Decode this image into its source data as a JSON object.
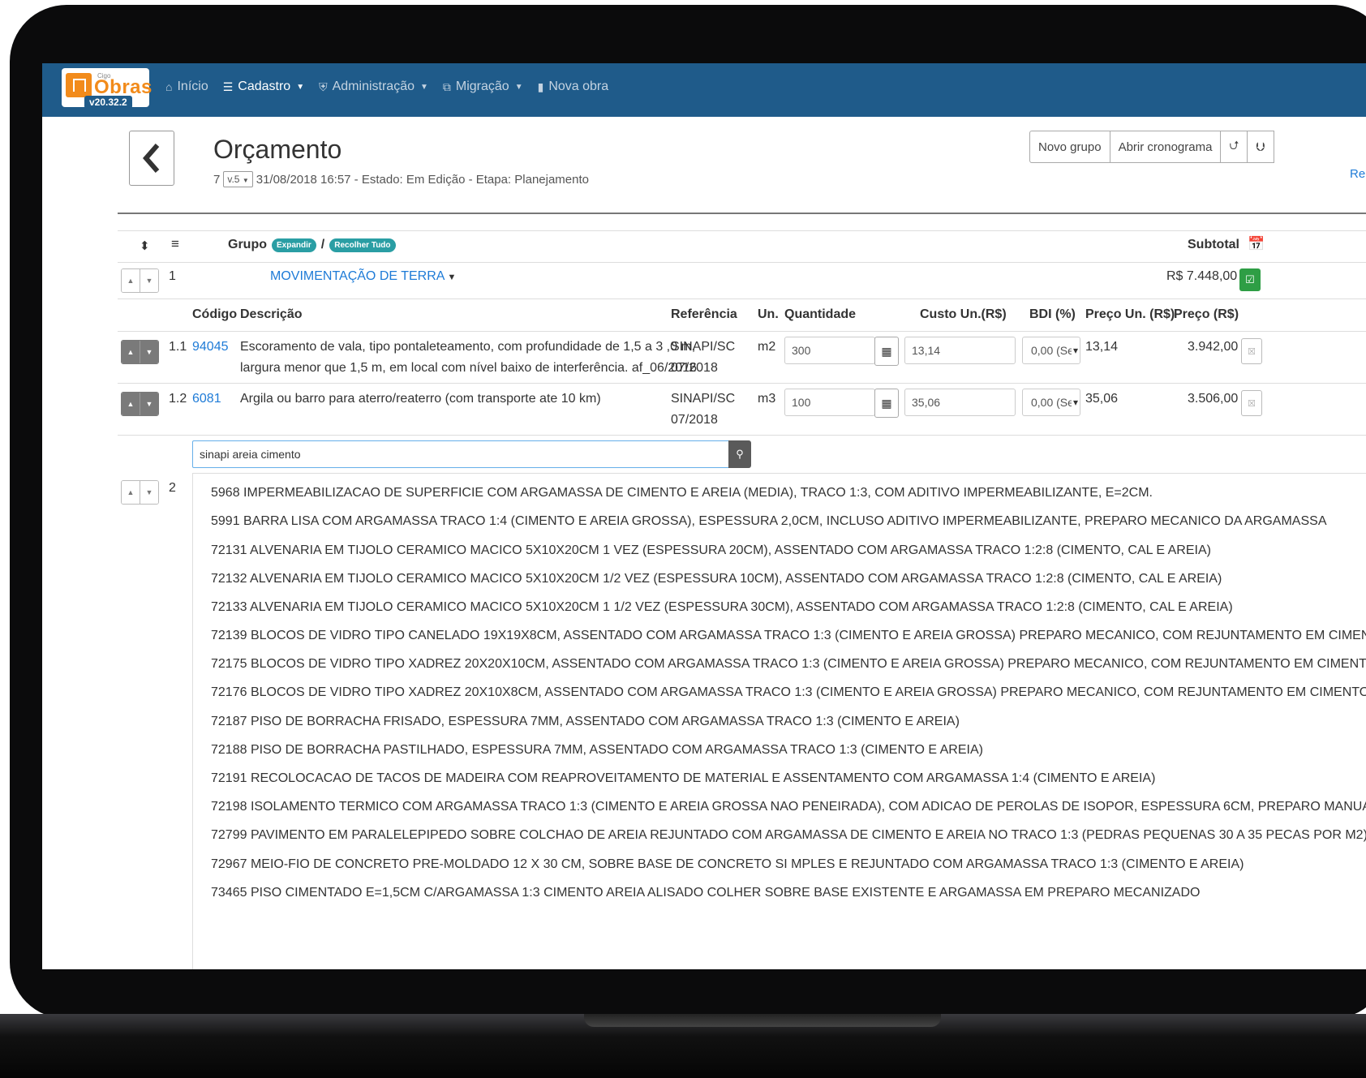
{
  "app": {
    "logo_small": "Cigo",
    "logo_brand": "Obras",
    "version": "v20.32.2"
  },
  "navbar": {
    "items": [
      {
        "label": "Início",
        "icon": "home-icon",
        "active": false,
        "dropdown": false
      },
      {
        "label": "Cadastro",
        "icon": "database-icon",
        "active": true,
        "dropdown": true
      },
      {
        "label": "Administração",
        "icon": "shield-icon",
        "active": false,
        "dropdown": true
      },
      {
        "label": "Migração",
        "icon": "copy-icon",
        "active": false,
        "dropdown": true
      },
      {
        "label": "Nova obra",
        "icon": "file-icon",
        "active": false,
        "dropdown": false
      }
    ]
  },
  "page": {
    "title": "Orçamento",
    "id": "7",
    "version": "v.5",
    "meta": "31/08/2018 16:57 - Estado: Em Edição - Etapa: Planejamento",
    "actions": {
      "novo_grupo": "Novo grupo",
      "abrir_cronograma": "Abrir cronograma",
      "upload_icon": "upload-icon",
      "download_icon": "download-icon"
    },
    "relink": "Re"
  },
  "table": {
    "header": {
      "grupo": "Grupo",
      "expandir": "Expandir",
      "separator": "/",
      "recolher": "Recolher Tudo",
      "subtotal": "Subtotal"
    },
    "groups": [
      {
        "number": "1",
        "name": "MOVIMENTAÇÃO DE TERRA",
        "subtotal": "R$ 7.448,00"
      },
      {
        "number": "2"
      }
    ],
    "columns": {
      "codigo": "Código",
      "descricao": "Descrição",
      "referencia": "Referência",
      "un": "Un.",
      "quantidade": "Quantidade",
      "custo": "Custo Un.(R$)",
      "bdi": "BDI (%)",
      "preco_un": "Preço Un. (R$)",
      "preco": "Preço (R$)"
    },
    "items": [
      {
        "num": "1.1",
        "code": "94045",
        "desc_line1": "Escoramento de vala, tipo pontaleteamento, com profundidade de 1,5 a 3 ,0 m,",
        "desc_line2": "largura menor que 1,5 m, em local com nível baixo de interferência. af_06/2016",
        "ref_line1": "SINAPI/SC",
        "ref_line2": "07/2018",
        "un": "m2",
        "quantidade": "300",
        "custo": "13,14",
        "bdi": "0,00 (Se",
        "preco_un": "13,14",
        "preco": "3.942,00"
      },
      {
        "num": "1.2",
        "code": "6081",
        "desc_line1": "Argila ou barro para aterro/reaterro (com transporte ate 10 km)",
        "desc_line2": "",
        "ref_line1": "SINAPI/SC",
        "ref_line2": "07/2018",
        "un": "m3",
        "quantidade": "100",
        "custo": "35,06",
        "bdi": "0,00 (Se",
        "preco_un": "35,06",
        "preco": "3.506,00"
      }
    ]
  },
  "search": {
    "value": "sinapi areia cimento",
    "suggestions": [
      "5968 IMPERMEABILIZACAO DE SUPERFICIE COM ARGAMASSA DE CIMENTO E AREIA (MEDIA), TRACO 1:3, COM ADITIVO IMPERMEABILIZANTE, E=2CM.",
      "5991 BARRA LISA COM ARGAMASSA TRACO 1:4 (CIMENTO E AREIA GROSSA), ESPESSURA 2,0CM, INCLUSO ADITIVO IMPERMEABILIZANTE, PREPARO MECANICO DA ARGAMASSA",
      "72131 ALVENARIA EM TIJOLO CERAMICO MACICO 5X10X20CM 1 VEZ (ESPESSURA 20CM), ASSENTADO COM ARGAMASSA TRACO 1:2:8 (CIMENTO, CAL E AREIA)",
      "72132 ALVENARIA EM TIJOLO CERAMICO MACICO 5X10X20CM 1/2 VEZ (ESPESSURA 10CM), ASSENTADO COM ARGAMASSA TRACO 1:2:8 (CIMENTO, CAL E AREIA)",
      "72133 ALVENARIA EM TIJOLO CERAMICO MACICO 5X10X20CM 1 1/2 VEZ (ESPESSURA 30CM), ASSENTADO COM ARGAMASSA TRACO 1:2:8 (CIMENTO, CAL E AREIA)",
      "72139 BLOCOS DE VIDRO TIPO CANELADO 19X19X8CM, ASSENTADO COM ARGAMASSA TRACO 1:3 (CIMENTO E AREIA GROSSA) PREPARO MECANICO, COM REJUNTAMENTO EM CIMEN",
      "72175 BLOCOS DE VIDRO TIPO XADREZ 20X20X10CM, ASSENTADO COM ARGAMASSA TRACO 1:3 (CIMENTO E AREIA GROSSA) PREPARO MECANICO, COM REJUNTAMENTO EM CIMENTO",
      "72176 BLOCOS DE VIDRO TIPO XADREZ 20X10X8CM, ASSENTADO COM ARGAMASSA TRACO 1:3 (CIMENTO E AREIA GROSSA) PREPARO MECANICO, COM REJUNTAMENTO EM CIMENTO",
      "72187 PISO DE BORRACHA FRISADO, ESPESSURA 7MM, ASSENTADO COM ARGAMASSA TRACO 1:3 (CIMENTO E AREIA)",
      "72188 PISO DE BORRACHA PASTILHADO, ESPESSURA 7MM, ASSENTADO COM ARGAMASSA TRACO 1:3 (CIMENTO E AREIA)",
      "72191 RECOLOCACAO DE TACOS DE MADEIRA COM REAPROVEITAMENTO DE MATERIAL E ASSENTAMENTO COM ARGAMASSA 1:4 (CIMENTO E AREIA)",
      "72198 ISOLAMENTO TERMICO COM ARGAMASSA TRACO 1:3 (CIMENTO E AREIA GROSSA NAO PENEIRADA), COM ADICAO DE PEROLAS DE ISOPOR, ESPESSURA 6CM, PREPARO MANUA",
      "72799 PAVIMENTO EM PARALELEPIPEDO SOBRE COLCHAO DE AREIA REJUNTADO COM ARGAMASSA DE CIMENTO E AREIA NO TRACO 1:3 (PEDRAS PEQUENAS 30 A 35 PECAS POR M2)",
      "72967 MEIO-FIO DE CONCRETO PRE-MOLDADO 12 X 30 CM, SOBRE BASE DE CONCRETO SI MPLES E REJUNTADO COM ARGAMASSA TRACO 1:3 (CIMENTO E AREIA)",
      "73465 PISO CIMENTADO E=1,5CM C/ARGAMASSA 1:3 CIMENTO AREIA ALISADO COLHER SOBRE BASE EXISTENTE E ARGAMASSA EM PREPARO MECANIZADO"
    ]
  },
  "colors": {
    "navbar": "#1f5b8a",
    "link": "#1e7bd7",
    "pill": "#2a9ea4",
    "green": "#2e9e45",
    "logo_orange": "#f28b1b"
  }
}
